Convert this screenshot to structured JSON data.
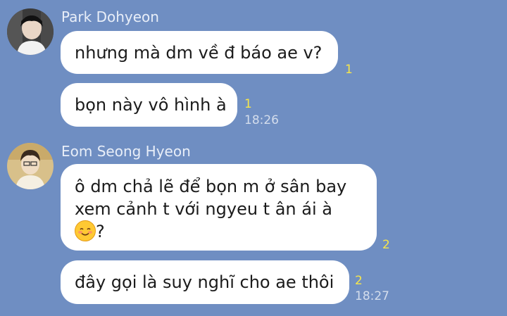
{
  "groups": [
    {
      "sender": "Park Dohyeon",
      "avatar_icon": "profile-photo-icon",
      "messages": [
        {
          "text": "nhưng mà dm về đ báo ae v?",
          "unread": "1",
          "time": ""
        },
        {
          "text": "bọn này vô hình à",
          "unread": "1",
          "time": "18:26"
        }
      ]
    },
    {
      "sender": "Eom Seong Hyeon",
      "avatar_icon": "profile-photo-icon",
      "messages": [
        {
          "lines": [
            "ô dm chả lẽ để bọn m ở sân bay",
            "xem cảnh t với ngyeu t ân ái à",
            "?"
          ],
          "emoji": "smiling-blush-emoji",
          "unread": "2",
          "time": ""
        },
        {
          "text": "đây gọi là suy nghĩ cho ae thôi",
          "unread": "2",
          "time": "18:27"
        }
      ]
    }
  ],
  "colors": {
    "background": "#6f8ec2",
    "bubble": "#ffffff",
    "unread_count": "#f7e64a",
    "timestamp": "#d4ddec",
    "sender_name": "#e8eef8"
  }
}
